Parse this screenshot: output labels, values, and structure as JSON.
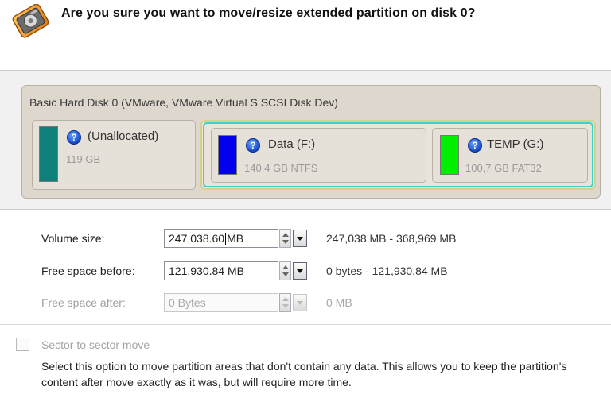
{
  "dialog": {
    "question": "Are you sure you want to move/resize extended partition on disk 0?"
  },
  "disk": {
    "title": "Basic Hard Disk 0 (VMware, VMware Virtual S SCSI Disk Dev)",
    "partitions": [
      {
        "name": "(Unallocated)",
        "info": "119 GB",
        "color": "#0f7f7a"
      },
      {
        "name": "Data (F:)",
        "info": "140,4 GB NTFS",
        "color": "#0000ee"
      },
      {
        "name": "TEMP (G:)",
        "info": "100,7 GB FAT32",
        "color": "#00ee00"
      }
    ]
  },
  "form": {
    "volume_size": {
      "label": "Volume size:",
      "value_before_caret": "247,038.60",
      "value_after_caret": "MB",
      "range": "247,038 MB - 368,969 MB"
    },
    "free_before": {
      "label": "Free space before:",
      "value": "121,930.84 MB",
      "range": "0 bytes - 121,930.84 MB"
    },
    "free_after": {
      "label": "Free space after:",
      "value": "0 Bytes",
      "range": "0 MB"
    }
  },
  "sector": {
    "label": "Sector to sector move",
    "checked": false,
    "description": "Select this option to move partition areas that don't contain any data. This allows you to keep the partition's content after move exactly as it was, but will require more time."
  }
}
